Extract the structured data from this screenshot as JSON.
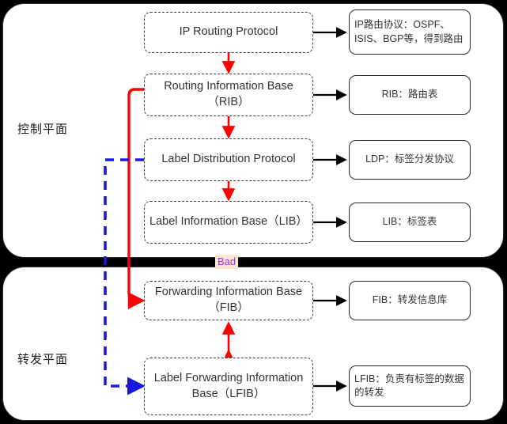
{
  "planes": {
    "control": {
      "label": "控制平面"
    },
    "forwarding": {
      "label": "转发平面"
    }
  },
  "nodes": {
    "ip_routing_protocol": "IP Routing Protocol",
    "rib": "Routing Information Base（RIB）",
    "ldp": "Label Distribution Protocol",
    "lib": "Label Information Base（LIB）",
    "fib": "Forwarding Information Base（FIB）",
    "lfib": "Label Forwarding Information Base（LFIB）"
  },
  "notes": {
    "ip_routing_protocol": "IP路由协议：OSPF、ISIS、BGP等，得到路由",
    "rib": "RIB：路由表",
    "ldp": "LDP：标签分发协议",
    "lib": "LIB：标签表",
    "fib": "FIB：转发信息库",
    "lfib": "LFIB：负责有标签的数据的转发"
  },
  "overlay": {
    "bad_tag": "Bad"
  },
  "colors": {
    "red_flow": "#ff0000",
    "blue_flow": "#1818e0",
    "black_connector": "#000000",
    "plane_border": "#2b2b2b",
    "node_border": "#3a3a3a",
    "bad_tag_bg": "#ffe6d0",
    "bad_tag_fg": "#9b30d9",
    "canvas": "#000000",
    "plane_fill": "#ffffff"
  }
}
